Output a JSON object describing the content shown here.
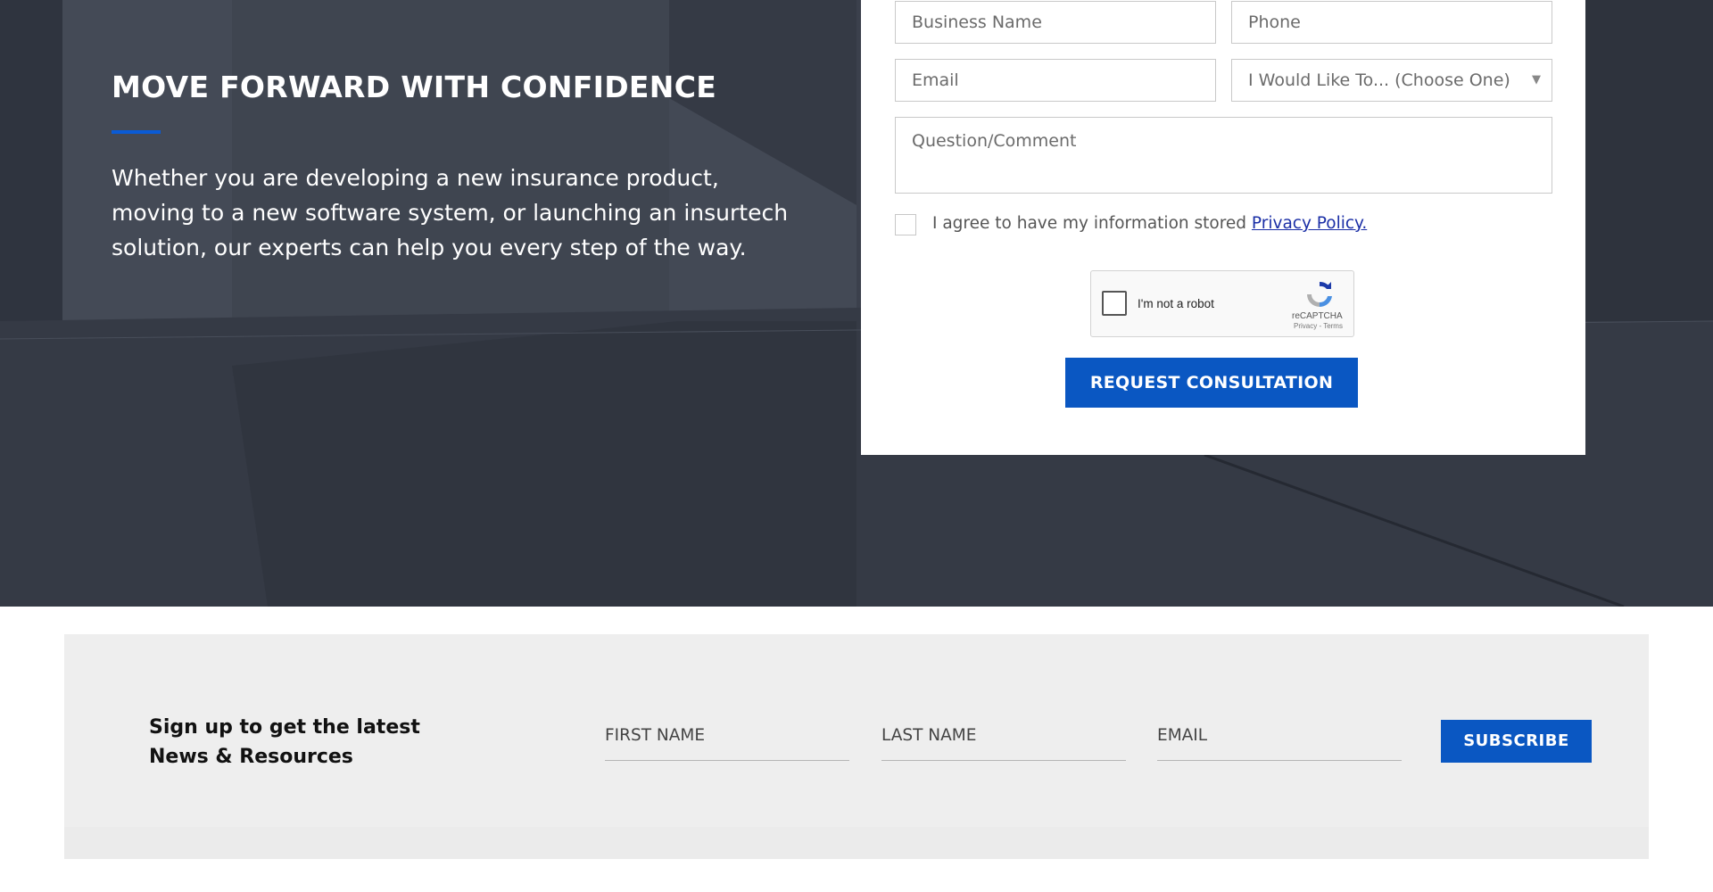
{
  "hero": {
    "title": "MOVE FORWARD WITH CONFIDENCE",
    "text": "Whether you are developing a new insurance product, moving to a new software system, or launching an insurtech solution, our experts can help you every step of the way."
  },
  "form": {
    "business_name_placeholder": "Business Name",
    "phone_placeholder": "Phone",
    "email_placeholder": "Email",
    "select_value": "I Would Like To... (Choose One)",
    "comment_placeholder": "Question/Comment",
    "agree_text": "I agree to have my information stored",
    "privacy_link": "Privacy Policy.",
    "recaptcha": {
      "label": "I'm not a robot",
      "brand": "reCAPTCHA",
      "terms": "Privacy - Terms"
    },
    "submit_label": "REQUEST CONSULTATION"
  },
  "newsletter": {
    "heading_line1": "Sign up to get the latest",
    "heading_line2": "News & Resources",
    "first_name_placeholder": "FIRST NAME",
    "last_name_placeholder": "LAST NAME",
    "email_placeholder": "EMAIL",
    "subscribe_label": "SUBSCRIBE"
  },
  "colors": {
    "accent": "#0a57c2",
    "hero_bg": "#3a3f4b",
    "newsletter_bg": "#eeeeee",
    "link": "#1a2ea6"
  }
}
